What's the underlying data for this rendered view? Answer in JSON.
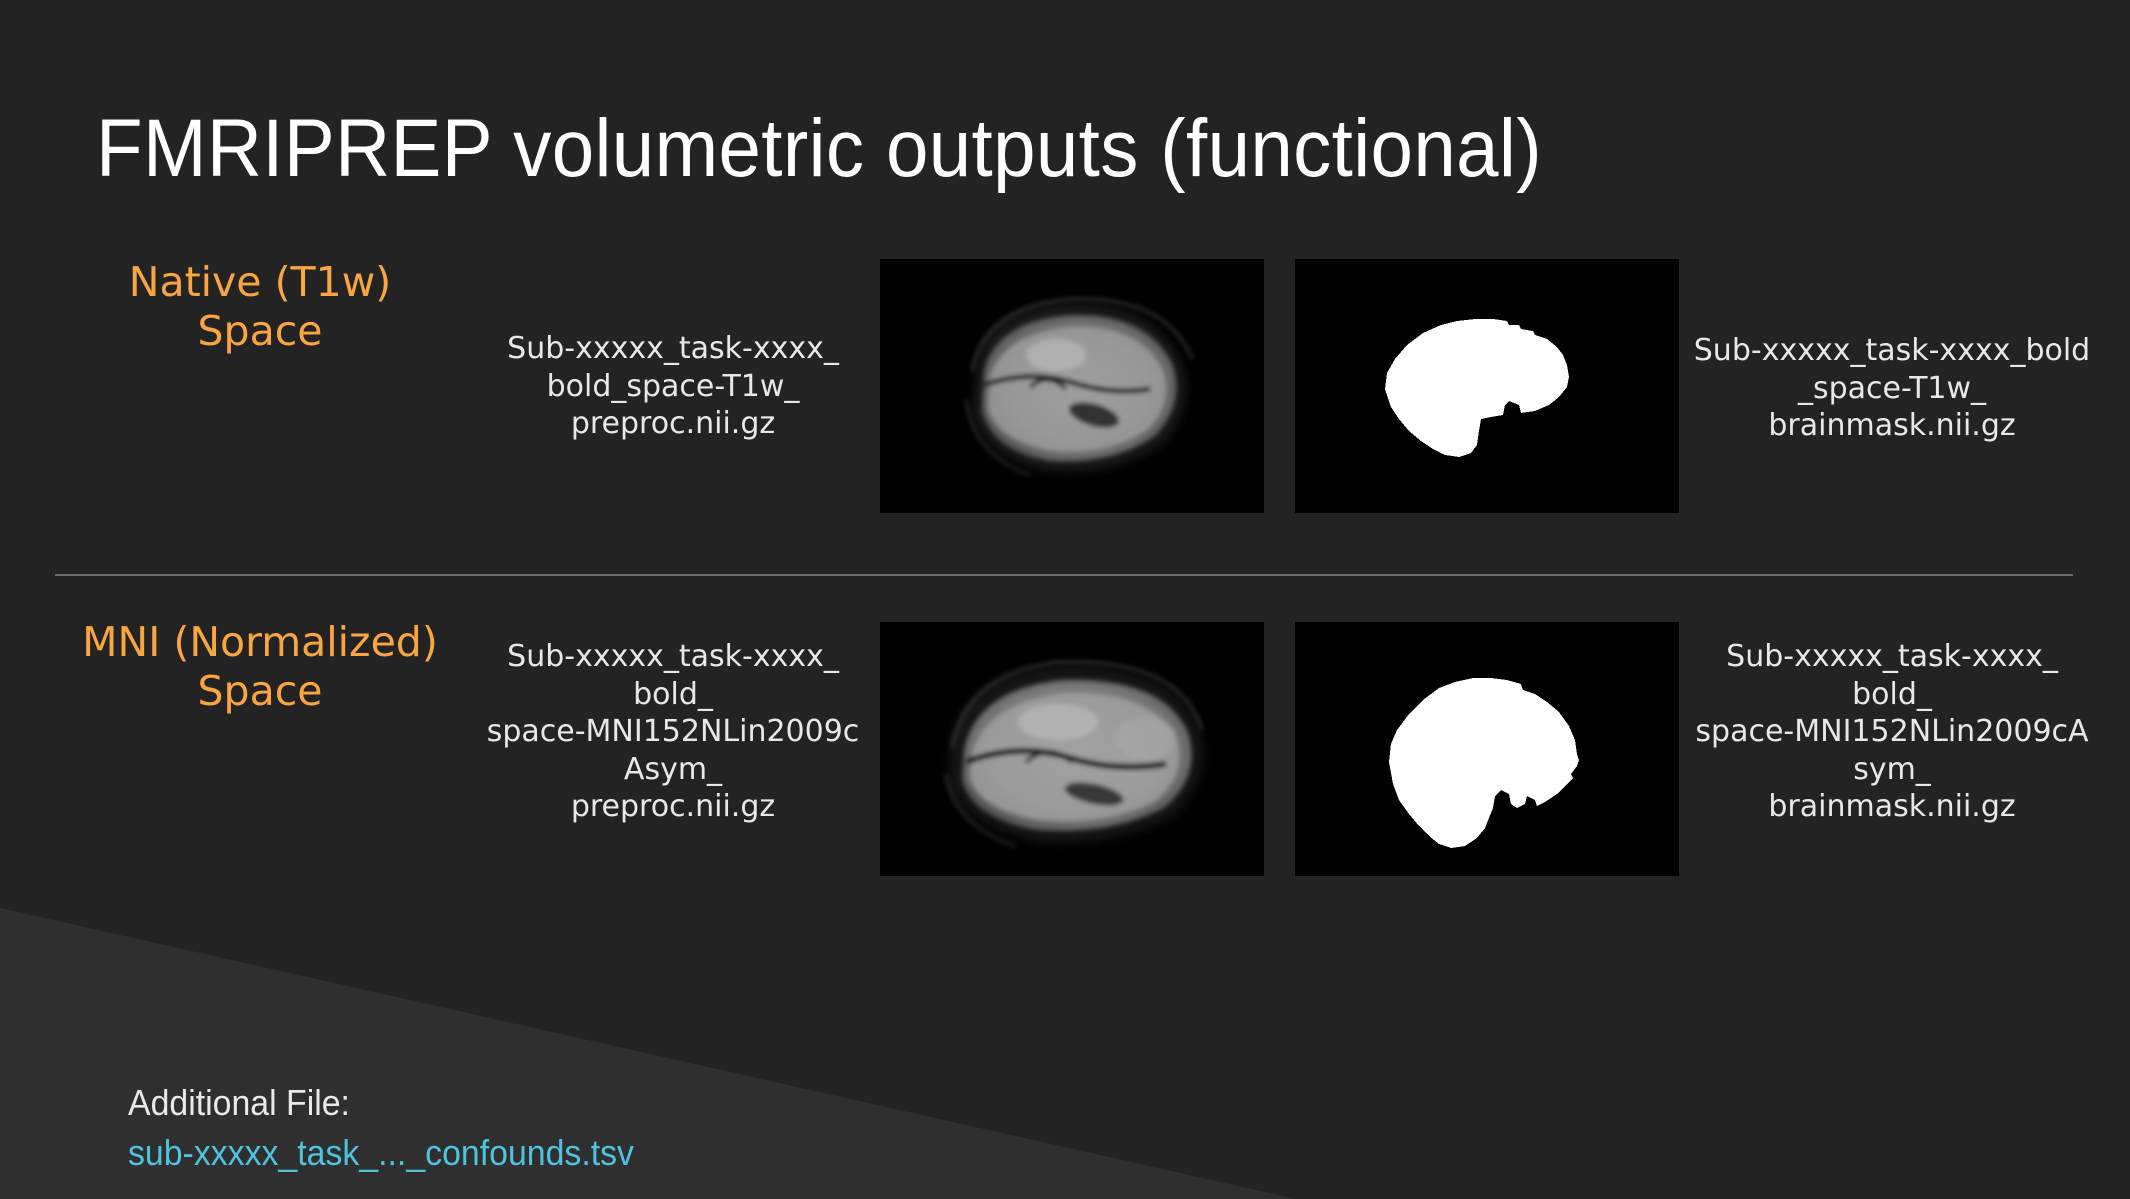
{
  "slide": {
    "title": "FMRIPREP volumetric outputs (functional)",
    "background_color": "#232323",
    "accent_color": "#f9a541",
    "link_color": "#4fc3dd"
  },
  "rows": [
    {
      "space_label": "Native\n(T1w)\nSpace",
      "preproc_filename": "Sub-xxxxx_task-xxxx_\nbold_space-T1w_\npreproc.nii.gz",
      "brainmask_filename": "Sub-xxxxx_task-xxxx_bold\n_space-T1w_\nbrainmask.nii.gz",
      "bold_image_alt": "sagittal-bold-slice",
      "mask_image_alt": "sagittal-brainmask-slice"
    },
    {
      "space_label": "MNI\n(Normalized)\nSpace",
      "preproc_filename": "Sub-xxxxx_task-xxxx_\nbold_\nspace-MNI152NLin2009cAsym_\npreproc.nii.gz",
      "brainmask_filename": "Sub-xxxxx_task-xxxx_\nbold_\nspace-MNI152NLin2009cAsym_\nbrainmask.nii.gz",
      "bold_image_alt": "sagittal-bold-slice-mni",
      "mask_image_alt": "sagittal-brainmask-slice-mni"
    }
  ],
  "footer": {
    "label": "Additional File:",
    "filename": "sub-xxxxx_task_..._confounds.tsv"
  }
}
